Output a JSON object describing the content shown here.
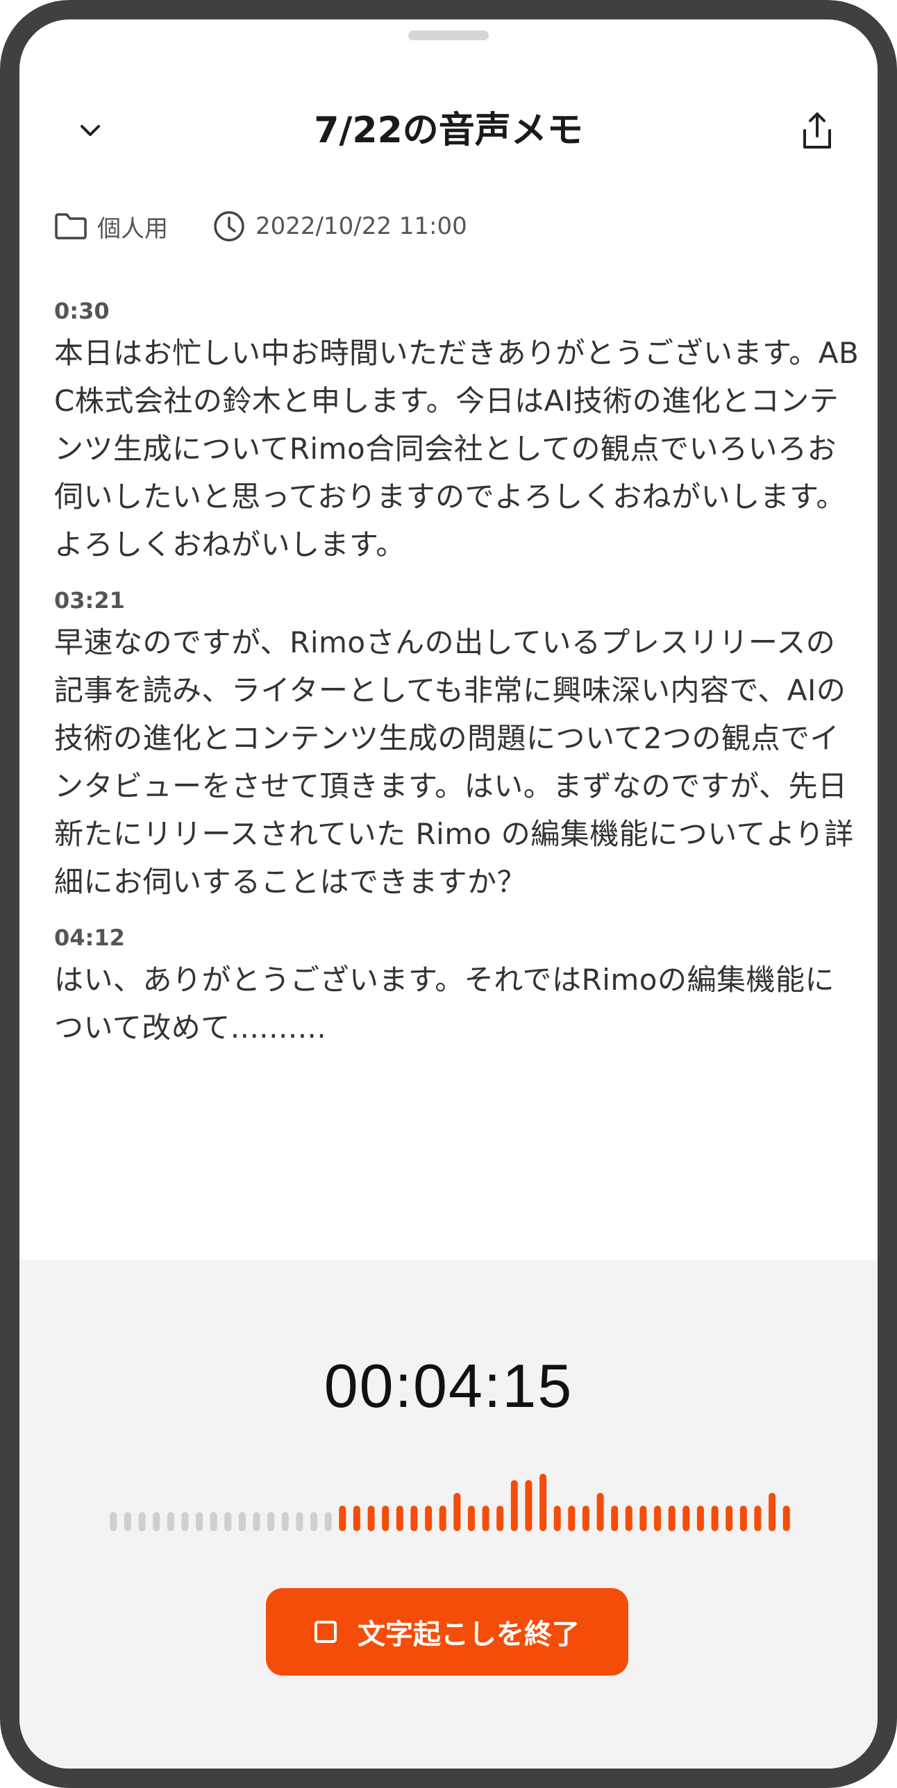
{
  "header": {
    "title": "7/22の音声メモ",
    "back_icon": "chevron-down-icon",
    "share_icon": "share-icon"
  },
  "meta": {
    "folder_icon": "folder-icon",
    "folder": "個人用",
    "clock_icon": "clock-icon",
    "datetime": "2022/10/22 11:00"
  },
  "transcript": [
    {
      "time": "0:30",
      "text": "本日はお忙しい中お時間いただきありがとうございます。ABC株式会社の鈴木と申します。今日はAI技術の進化とコンテンツ生成についてRimo合同会社としての観点でいろいろお伺いしたいと思っておりますのでよろしくおねがいします。よろしくおねがいします。"
    },
    {
      "time": "03:21",
      "text": "早速なのですが、Rimoさんの出しているプレスリリースの記事を読み、ライターとしても非常に興味深い内容で、AIの技術の進化とコンテンツ生成の問題について2つの観点でインタビューをさせて頂きます。はい。まずなのですが、先日新たにリリースされていた Rimo の編集機能についてより詳細にお伺いすることはできますか？"
    },
    {
      "time": "04:12",
      "text": "はい、ありがとうございます。それではRimoの編集機能について改めて.........."
    }
  ],
  "recorder": {
    "elapsed": "00:04:15",
    "levels": [
      0.3,
      0.3,
      0.3,
      0.3,
      0.3,
      0.3,
      0.3,
      0.3,
      0.3,
      0.3,
      0.3,
      0.3,
      0.3,
      0.3,
      0.3,
      0.3,
      0.4,
      0.4,
      0.4,
      0.4,
      0.4,
      0.4,
      0.4,
      0.4,
      0.6,
      0.4,
      0.4,
      0.4,
      0.8,
      0.8,
      0.9,
      0.4,
      0.4,
      0.4,
      0.6,
      0.4,
      0.4,
      0.4,
      0.4,
      0.4,
      0.4,
      0.4,
      0.4,
      0.4,
      0.4,
      0.4,
      0.6,
      0.4
    ],
    "inactive_count": 16,
    "active_color": "#f44d0a",
    "inactive_color": "#cfcfcf",
    "stop_icon": "stop-icon",
    "stop_label": "文字起こしを終了"
  }
}
